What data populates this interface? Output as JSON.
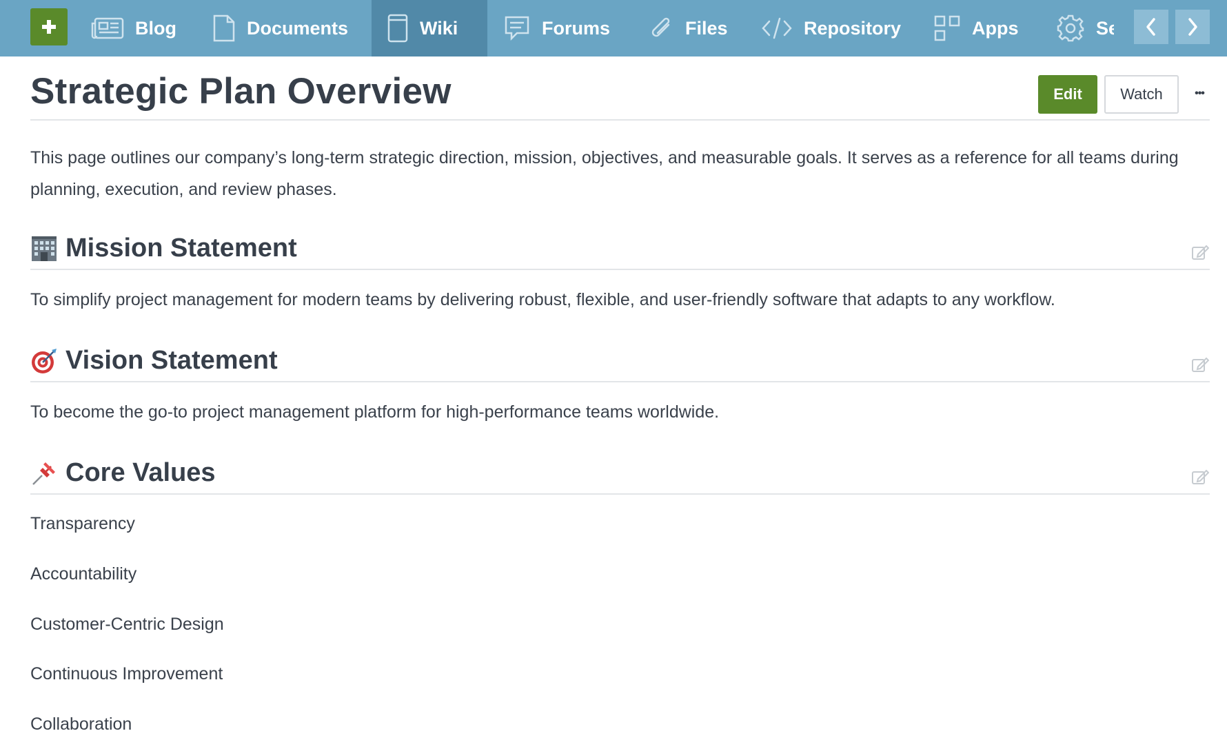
{
  "nav": {
    "add_label": "+",
    "tabs": [
      {
        "label": "Blog",
        "icon": "newspaper-icon"
      },
      {
        "label": "Documents",
        "icon": "document-icon"
      },
      {
        "label": "Wiki",
        "icon": "book-icon",
        "active": true
      },
      {
        "label": "Forums",
        "icon": "chat-bubble-icon"
      },
      {
        "label": "Files",
        "icon": "paperclip-icon"
      },
      {
        "label": "Repository",
        "icon": "code-icon"
      },
      {
        "label": "Apps",
        "icon": "grid-icon"
      },
      {
        "label": "Se",
        "icon": "gear-icon"
      }
    ]
  },
  "page": {
    "title": "Strategic Plan Overview",
    "edit_label": "Edit",
    "watch_label": "Watch",
    "more_label": "•••",
    "intro": "This page outlines our company’s long-term strategic direction, mission, objectives, and measurable goals. It serves as a reference for all teams during planning, execution, and review phases."
  },
  "sections": [
    {
      "emoji": "office-building-icon",
      "title": "Mission Statement",
      "text": "To simplify project management for modern teams by delivering robust, flexible, and user-friendly software that adapts to any workflow."
    },
    {
      "emoji": "target-dart-icon",
      "title": "Vision Statement",
      "text": "To become the go-to project management platform for high-performance teams worldwide."
    },
    {
      "emoji": "pushpin-icon",
      "title": "Core Values",
      "items": [
        "Transparency",
        "Accountability",
        "Customer-Centric Design",
        "Continuous Improvement",
        "Collaboration"
      ]
    }
  ],
  "colors": {
    "topbar": "#6aa5c4",
    "topbar_active": "#5189a8",
    "accent_green": "#5a8a2a"
  }
}
